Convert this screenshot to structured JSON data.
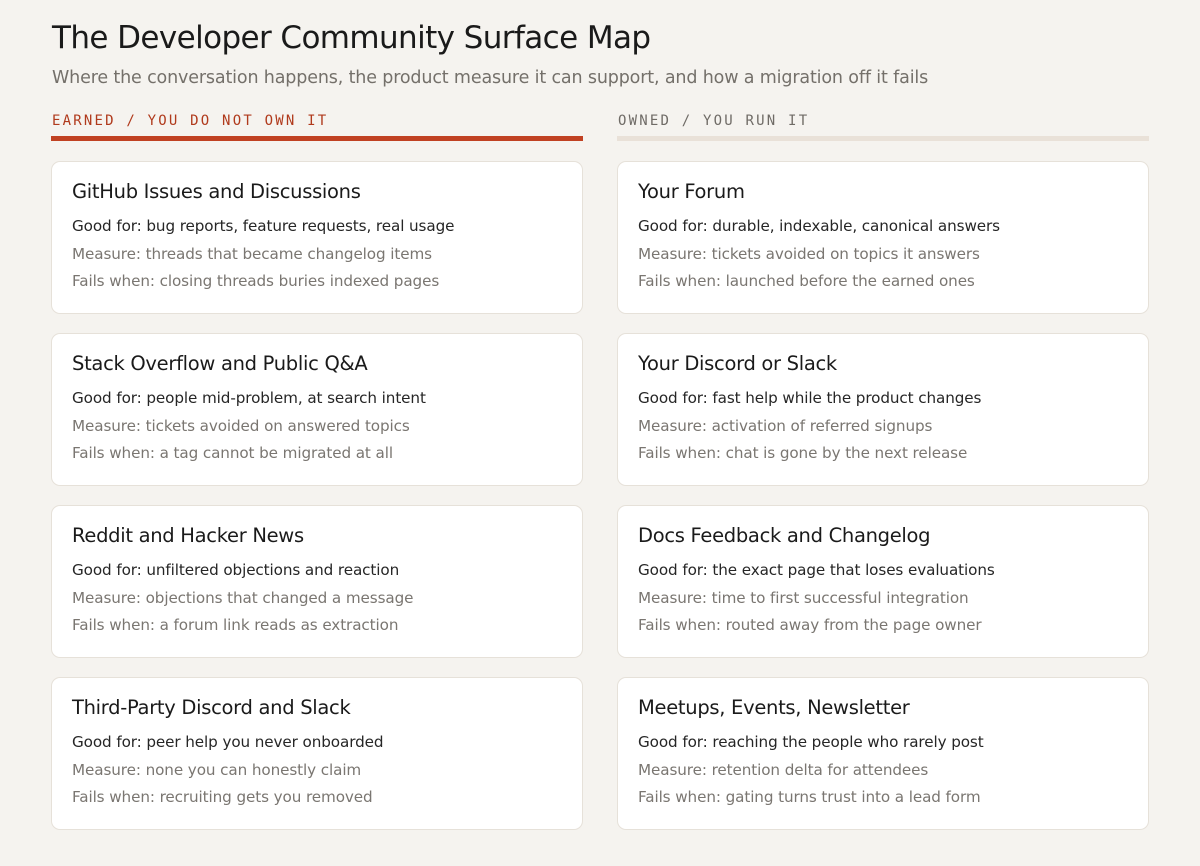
{
  "title": "The Developer Community Surface Map",
  "subtitle": "Where the conversation happens, the product measure it can support, and how a migration off it fails",
  "columns": [
    {
      "heading": "EARNED / YOU DO NOT OWN IT",
      "accent_color": "#c04122",
      "cards": [
        {
          "title": "GitHub Issues and Discussions",
          "good_for": "Good for: bug reports, feature requests, real usage",
          "measure": "Measure: threads that became changelog items",
          "fails_when": "Fails when: closing threads buries indexed pages"
        },
        {
          "title": "Stack Overflow and Public Q&A",
          "good_for": "Good for: people mid-problem, at search intent",
          "measure": "Measure: tickets avoided on answered topics",
          "fails_when": "Fails when: a tag cannot be migrated at all"
        },
        {
          "title": "Reddit and Hacker News",
          "good_for": "Good for: unfiltered objections and reaction",
          "measure": "Measure: objections that changed a message",
          "fails_when": "Fails when: a forum link reads as extraction"
        },
        {
          "title": "Third-Party Discord and Slack",
          "good_for": "Good for: peer help you never onboarded",
          "measure": "Measure: none you can honestly claim",
          "fails_when": "Fails when: recruiting gets you removed"
        }
      ]
    },
    {
      "heading": "OWNED / YOU RUN IT",
      "accent_color": "#e9e1d8",
      "cards": [
        {
          "title": "Your Forum",
          "good_for": "Good for: durable, indexable, canonical answers",
          "measure": "Measure: tickets avoided on topics it answers",
          "fails_when": "Fails when: launched before the earned ones"
        },
        {
          "title": "Your Discord or Slack",
          "good_for": "Good for: fast help while the product changes",
          "measure": "Measure: activation of referred signups",
          "fails_when": "Fails when: chat is gone by the next release"
        },
        {
          "title": "Docs Feedback and Changelog",
          "good_for": "Good for: the exact page that loses evaluations",
          "measure": "Measure: time to first successful integration",
          "fails_when": "Fails when: routed away from the page owner"
        },
        {
          "title": "Meetups, Events, Newsletter",
          "good_for": "Good for: reaching the people who rarely post",
          "measure": "Measure: retention delta for attendees",
          "fails_when": "Fails when: gating turns trust into a lead form"
        }
      ]
    }
  ]
}
